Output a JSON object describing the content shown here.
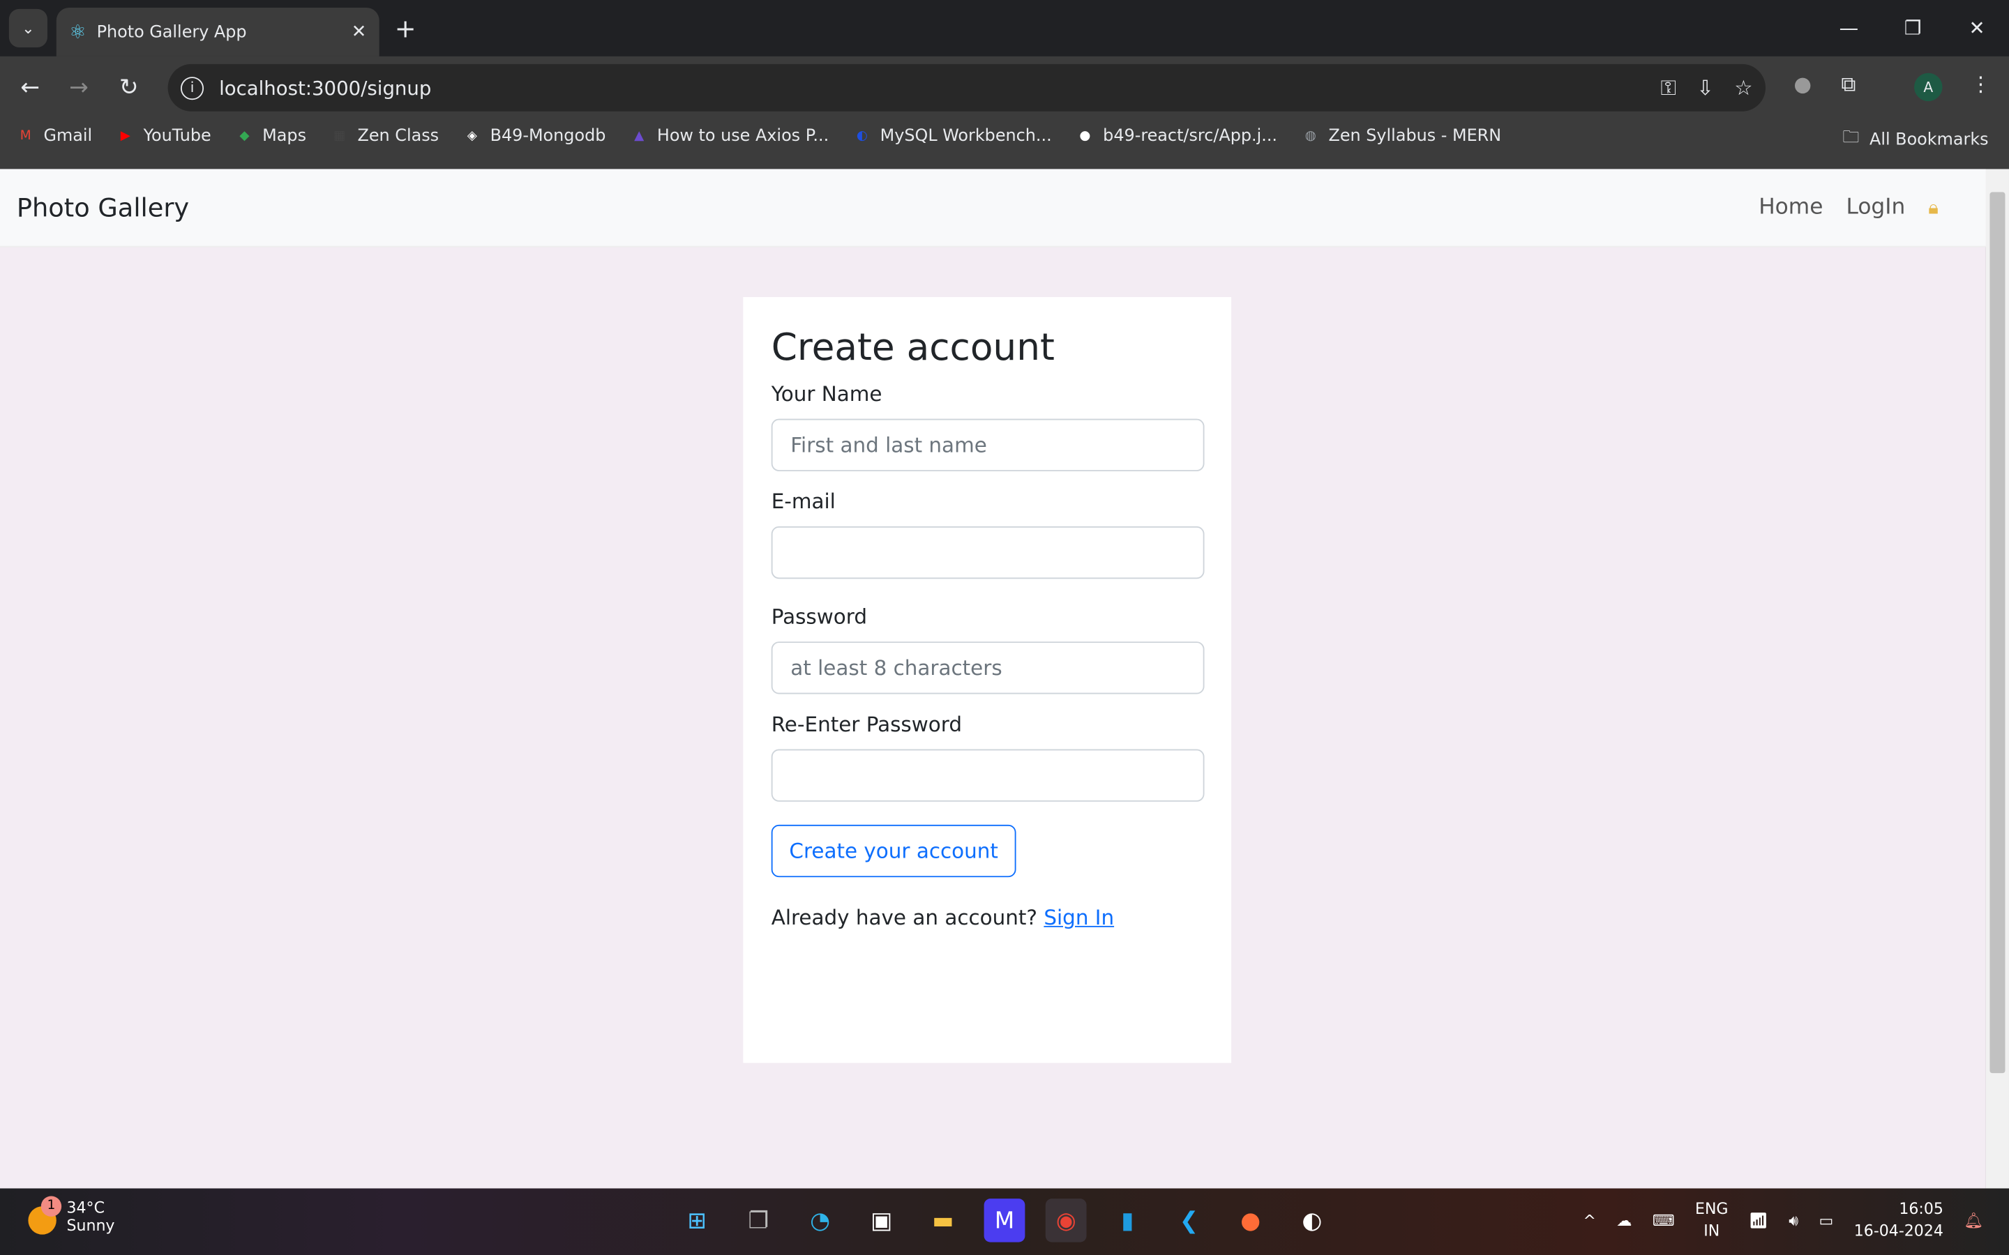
{
  "browser": {
    "tab_title": "Photo Gallery App",
    "url": "localhost:3000/signup",
    "bookmarks": [
      {
        "label": "Gmail",
        "icon": "gmail-icon",
        "color": "#ea4335",
        "glyph": "M"
      },
      {
        "label": "YouTube",
        "icon": "youtube-icon",
        "color": "#ff0000",
        "glyph": "▶"
      },
      {
        "label": "Maps",
        "icon": "maps-icon",
        "color": "#34a853",
        "glyph": "◆"
      },
      {
        "label": "Zen Class",
        "icon": "zen-class-icon",
        "color": "#444444",
        "glyph": "▦"
      },
      {
        "label": "B49-Mongodb",
        "icon": "codepen-icon",
        "color": "#ffffff",
        "glyph": "◈"
      },
      {
        "label": "How to use Axios P...",
        "icon": "rocket-icon",
        "color": "#6c4ccf",
        "glyph": "▲"
      },
      {
        "label": "MySQL Workbench...",
        "icon": "mysql-icon",
        "color": "#1e4fe0",
        "glyph": "◐"
      },
      {
        "label": "b49-react/src/App.j...",
        "icon": "github-icon",
        "color": "#ffffff",
        "glyph": "●"
      },
      {
        "label": "Zen Syllabus - MERN",
        "icon": "globe-icon",
        "color": "#9aa0a6",
        "glyph": "◍"
      }
    ],
    "all_bookmarks": "All Bookmarks",
    "profile_initial": "A"
  },
  "app": {
    "brand": "Photo Gallery",
    "nav": {
      "home": "Home",
      "login": "LogIn"
    },
    "form": {
      "title": "Create account",
      "name_label": "Your Name",
      "name_placeholder": "First and last name",
      "email_label": "E-mail",
      "password_label": "Password",
      "password_placeholder": "at least 8 characters",
      "repassword_label": "Re-Enter Password",
      "submit": "Create your account",
      "already": "Already have an account?",
      "signin": "Sign In"
    }
  },
  "taskbar": {
    "temp": "34°C",
    "weather": "Sunny",
    "notif_count": "1",
    "lang1": "ENG",
    "lang2": "IN",
    "time": "16:05",
    "date": "16-04-2024"
  }
}
